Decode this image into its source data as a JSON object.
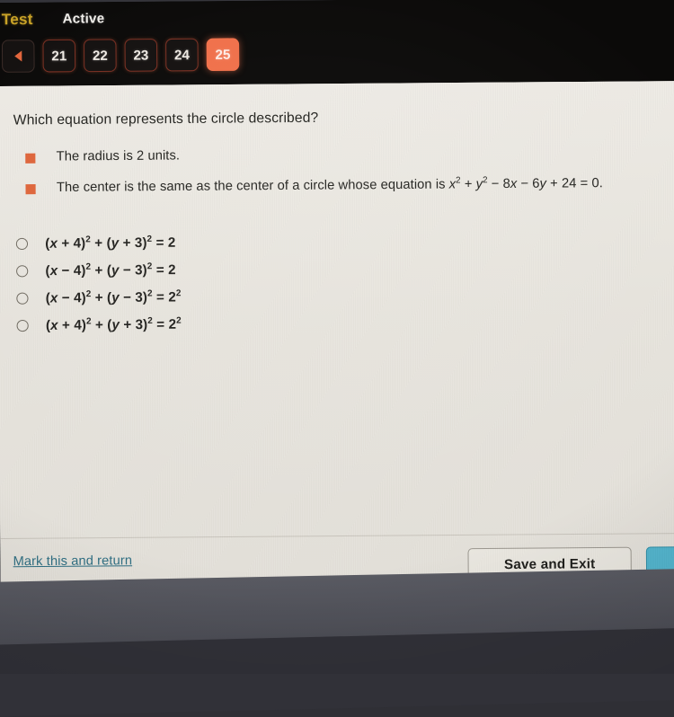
{
  "toolbar": {
    "test_label": "Test",
    "status_label": "Active",
    "prev_button_label": "",
    "pages": [
      {
        "label": "21",
        "active": false
      },
      {
        "label": "22",
        "active": false
      },
      {
        "label": "23",
        "active": false
      },
      {
        "label": "24",
        "active": false
      },
      {
        "label": "25",
        "active": true
      }
    ],
    "active_color": "#f0704a",
    "test_color": "#c9a227",
    "border_color": "#7a2f22"
  },
  "question": {
    "prompt": "Which equation represents the circle described?",
    "bullets": [
      "The radius is 2 units.",
      "The center is the same as the center of a circle whose equation is x² + y² − 8x − 6y + 24 = 0."
    ],
    "bullet_marker_color": "#e0653a"
  },
  "options": [
    {
      "id": "a",
      "text": "(x + 4)² + (y + 3)² = 2",
      "selected": false
    },
    {
      "id": "b",
      "text": "(x − 4)² + (y − 3)² = 2",
      "selected": false
    },
    {
      "id": "c",
      "text": "(x − 4)² + (y − 3)² = 2²",
      "selected": false
    },
    {
      "id": "d",
      "text": "(x + 4)² + (y + 3)² = 2²",
      "selected": false
    }
  ],
  "footer": {
    "mark_link": "Mark this and return",
    "save_button": "Save and Exit",
    "next_button": "",
    "link_color": "#2f6f83",
    "next_button_color": "#53b6cf"
  }
}
